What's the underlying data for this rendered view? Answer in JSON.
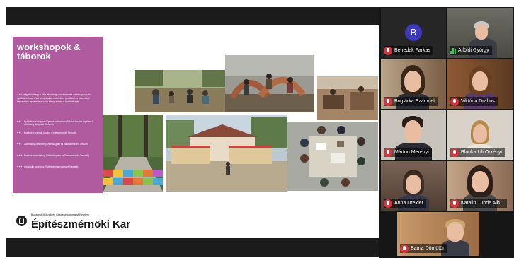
{
  "slide": {
    "title": "workshopok & táborok",
    "description": "A kar hallgatóinak egy-e több lehetősége van építészeti workshopokon és építőtáborokban részt venni ahol az elméletben tanultakat és tervezéssel kapcsolatos tapasztalatot valós környezetben is kipróbálhatják",
    "items": [
      {
        "bullet": "+ +",
        "text": "Építőtábor a Ferenczi Gyermekotthonban (Ryntser Beatrix Ingatlan + Közösség Szolgálat Tanszék)"
      },
      {
        "bullet": "+ +",
        "text": "Brakhkert szerkós, Munka (Építészmérnöki Tanszék)"
      },
      {
        "bullet": "+ +",
        "text": "Cadenaary-oktatótér (Szilárdságtani és Tartószerkezeti Tanszék)"
      },
      {
        "bullet": "+ + +",
        "text": "Betonkenu workshop (Szilárdságtani és Tartószerkezeti Tanszék)"
      },
      {
        "bullet": "+ + +",
        "text": "Ajtóstúdió workshop (Építészformaművészet Tanszék)"
      }
    ],
    "university": "Budapesti Műszaki és Gazdaságtudományi Egyetem",
    "faculty": "Építészmérnöki Kar",
    "accent_color": "#b05a9f"
  },
  "participants": [
    {
      "name": "Benedek Farkas",
      "initial": "B",
      "muted": true,
      "kind": "avatar"
    },
    {
      "name": "Alföldi György",
      "muted": false,
      "speaking": true
    },
    {
      "name": "Boglárka Szamuel",
      "muted": true
    },
    {
      "name": "Viktória Drahos",
      "muted": true
    },
    {
      "name": "Márton Merényi",
      "muted": true
    },
    {
      "name": "Blanka Lili Orkényi",
      "muted": true
    },
    {
      "name": "Anna Drexler",
      "muted": true
    },
    {
      "name": "Katalin Tünde Alb...",
      "muted": true
    },
    {
      "name": "Barna Dömötör",
      "muted": true
    }
  ],
  "colors": {
    "mute_red": "#d7363c",
    "speaking_green": "#2ecc52",
    "avatar_blue": "#3c3ab8"
  }
}
